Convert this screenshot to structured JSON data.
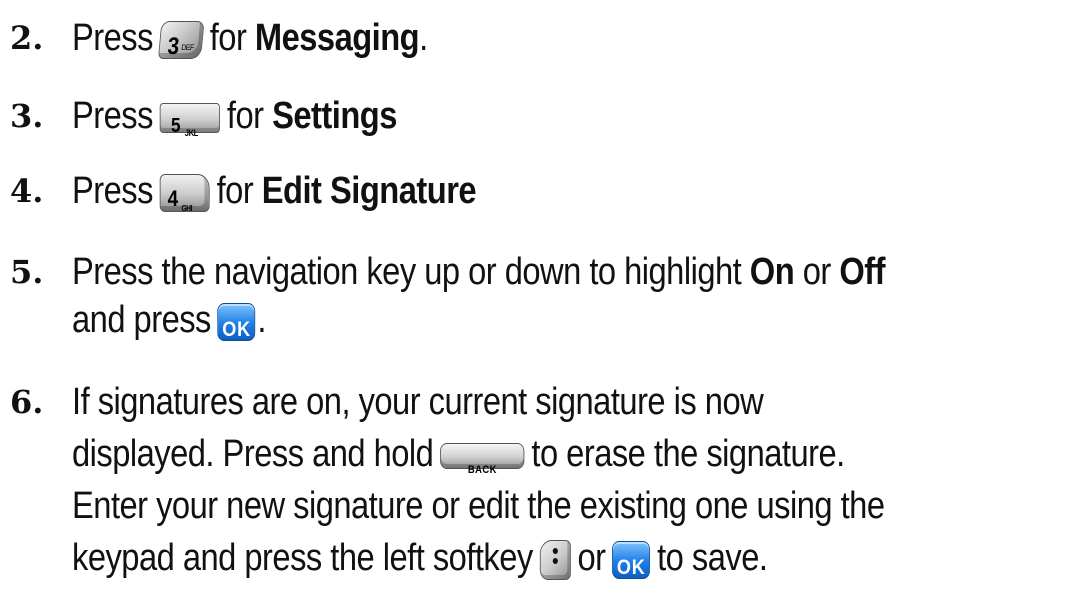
{
  "steps": [
    {
      "number": "2.",
      "press": "Press",
      "key_label": "3",
      "key_sub": "DEF",
      "for": "for",
      "target": "Messaging",
      "end": "."
    },
    {
      "number": "3.",
      "press": "Press",
      "key_label": "5",
      "key_sub": "JKL",
      "for": "for",
      "target": "Settings"
    },
    {
      "number": "4.",
      "press": "Press",
      "key_label": "4",
      "key_sub": "GHI",
      "for": "for",
      "target": "Edit Signature"
    },
    {
      "number": "5.",
      "line1_text": "Press the navigation key up or down to highlight",
      "opt_on": "On",
      "or": "or",
      "opt_off": "Off",
      "line2_text": "and press",
      "key_label": "OK",
      "end": "."
    },
    {
      "number": "6.",
      "line1": "If signatures are on, your current signature is now",
      "line2_a": "displayed. Press and hold",
      "back_label": "BACK",
      "line2_b": "to erase the signature.",
      "line3": "Enter your new signature or edit the existing one using the",
      "line4_a": "keypad and press the left softkey",
      "line4_or": "or",
      "ok_label": "OK",
      "line4_b": "to save."
    }
  ],
  "icons": [
    "key-3-icon",
    "key-5-icon",
    "key-4-icon",
    "ok-key-icon",
    "back-key-icon",
    "left-softkey-icon"
  ],
  "colors": {
    "ok_key": "#1e7ee6",
    "text": "#111111"
  }
}
